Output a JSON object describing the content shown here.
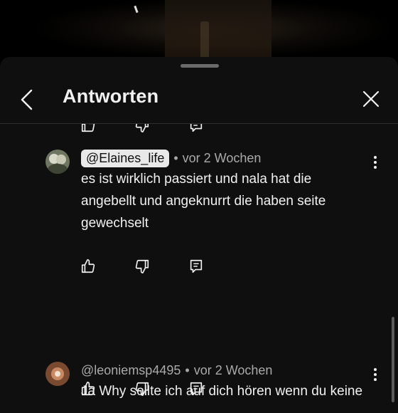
{
  "panel": {
    "title": "Antworten"
  },
  "comments": [
    {
      "handle": "@Elaines_life",
      "time": "vor 2 Wochen",
      "text": "es ist wirklich passiert und nala hat die angebellt und angeknurrt die haben seite gewechselt"
    },
    {
      "handle": "@leoniemsp4495",
      "time": "vor 2 Wochen",
      "text": "Ja Why sollte ich auf dich hören wenn du keine Ahnung von mein Pferd hast?"
    }
  ],
  "icons": {
    "back": "chevron-left-icon",
    "close": "close-icon",
    "like": "thumbs-up-icon",
    "dislike": "thumbs-down-icon",
    "reply": "reply-icon",
    "more": "more-vertical-icon"
  },
  "colors": {
    "sheet_bg": "#0f0f0f",
    "text_primary": "#f1f1f1",
    "text_secondary": "#aaaaaa",
    "chip_bg": "#e9e9e9"
  }
}
